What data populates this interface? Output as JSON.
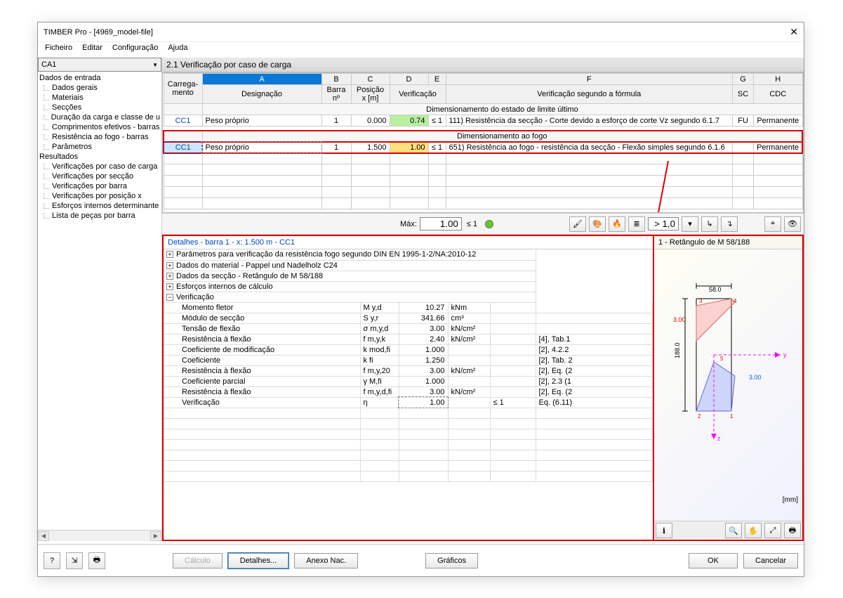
{
  "window": {
    "title": "TIMBER Pro - [4969_model-file]",
    "close": "✕"
  },
  "menu": [
    "Ficheiro",
    "Editar",
    "Configuração",
    "Ajuda"
  ],
  "combo": "CA1",
  "tree_root1": "Dados de entrada",
  "tree_items1": [
    "Dados gerais",
    "Materiais",
    "Secções",
    "Duração da carga e classe de u",
    "Comprimentos efetivos - barras",
    "Resistência ao fogo - barras",
    "Parâmetros"
  ],
  "tree_root2": "Resultados",
  "tree_items2": [
    "Verificações por caso de carga",
    "Verificações por secção",
    "Verificações por barra",
    "Verificações por posição x",
    "Esforços internos determinante",
    "Lista de peças por barra"
  ],
  "section": "2.1  Verificação por caso de carga",
  "cols_letters": [
    "A",
    "B",
    "C",
    "D",
    "E",
    "F",
    "G",
    "H"
  ],
  "cols": {
    "carreg": "Carrega-",
    "mento": "mento",
    "desig": "Designação",
    "barra": "Barra",
    "barra2": "nº",
    "pos": "Posição",
    "pos2": "x [m]",
    "ver": "Verificação",
    "formula": "Verificação segundo a fórmula",
    "sc": "SC",
    "cdc": "CDC"
  },
  "groups": {
    "ulm": "Dimensionamento do estado de limite último",
    "fire": "Dimensionamento ao fogo"
  },
  "rows": {
    "r1": {
      "cc": "CC1",
      "desig": "Peso próprio",
      "barra": "1",
      "pos": "0.000",
      "ratio": "0.74",
      "le1": "≤ 1",
      "num": "111)",
      "desc": "Resistência da secção - Corte devido a esforço de corte Vz segundo 6.1.7",
      "sc": "FU",
      "cdc": "Permanente"
    },
    "r2": {
      "cc": "CC1",
      "desig": "Peso próprio",
      "barra": "1",
      "pos": "1.500",
      "ratio": "1.00",
      "le1": "≤ 1",
      "num": "651)",
      "desc": "Resistência ao fogo - resistência da secção - Flexão simples segundo 6.1.6",
      "sc": "",
      "cdc": "Permanente"
    }
  },
  "max": {
    "label": "Máx:",
    "value": "1.00",
    "le1": "≤ 1"
  },
  "filter": {
    "thr": "> 1,0"
  },
  "details_title": "Detalhes - barra 1 - x: 1.500 m - CC1",
  "det_groups": [
    {
      "ex": "⊞",
      "txt": "Parâmetros para verificação da resistência fogo segundo DIN EN 1995-1-2/NA:2010-12"
    },
    {
      "ex": "⊞",
      "txt": "Dados do material - Pappel und Nadelholz C24"
    },
    {
      "ex": "⊞",
      "txt": "Dados da secção - Retângulo de M 58/188"
    },
    {
      "ex": "⊞",
      "txt": "Esforços internos de cálculo"
    },
    {
      "ex": "⊟",
      "txt": "Verificação"
    }
  ],
  "det_rows": [
    {
      "p": "Momento fletor",
      "s": "M y,d",
      "v": "10.27",
      "u": "kNm",
      "r": ""
    },
    {
      "p": "Módulo de secção",
      "s": "S y,r",
      "v": "341.66",
      "u": "cm³",
      "r": ""
    },
    {
      "p": "Tensão de flexão",
      "s": "σ m,y,d",
      "v": "3.00",
      "u": "kN/cm²",
      "r": ""
    },
    {
      "p": "Resistência à flexão",
      "s": "f m,y,k",
      "v": "2.40",
      "u": "kN/cm²",
      "r": "[4], Tab.1"
    },
    {
      "p": "Coeficiente de modificação",
      "s": "k mod,fi",
      "v": "1.000",
      "u": "",
      "r": "[2], 4.2.2"
    },
    {
      "p": "Coeficiente",
      "s": "k fi",
      "v": "1.250",
      "u": "",
      "r": "[2], Tab. 2"
    },
    {
      "p": "Resistência à flexão",
      "s": "f m,y,20",
      "v": "3.00",
      "u": "kN/cm²",
      "r": "[2], Eq. (2"
    },
    {
      "p": "Coeficiente parcial",
      "s": "γ M,fi",
      "v": "1.000",
      "u": "",
      "r": "[2], 2.3 (1"
    },
    {
      "p": "Resistência à flexão",
      "s": "f m,y,d,fi",
      "v": "3.00",
      "u": "kN/cm²",
      "r": "[2], Eq. (2"
    },
    {
      "p": "Verificação",
      "s": "η",
      "v": "1.00",
      "u": "",
      "r1": "≤ 1",
      "r": "Eq. (6.11)"
    }
  ],
  "section_preview": "1 - Retângulo de M 58/188",
  "diag": {
    "w": "58.0",
    "h": "188.0",
    "v3": "3.00",
    "v3b": "3.00",
    "n1": "1",
    "n2": "2",
    "n3": "3",
    "n4": "4",
    "n5": "5",
    "y": "y",
    "z": "z",
    "mm": "[mm]"
  },
  "buttons": {
    "calc": "Cálculo",
    "det": "Detalhes...",
    "anex": "Anexo Nac.",
    "graf": "Gráficos",
    "ok": "OK",
    "cancel": "Cancelar"
  },
  "icons": {
    "info": "ℹ",
    "zoom": "🔍",
    "hand": "✋",
    "axes": "⤢",
    "reset": "↺",
    "brush": "🖌",
    "pal": "🎨",
    "fire": "🔥",
    "sort": "≣",
    "in": "↳",
    "out": "↴",
    "eye": "👁",
    "print": "🖶",
    "help": "?",
    "export": "⇲"
  }
}
